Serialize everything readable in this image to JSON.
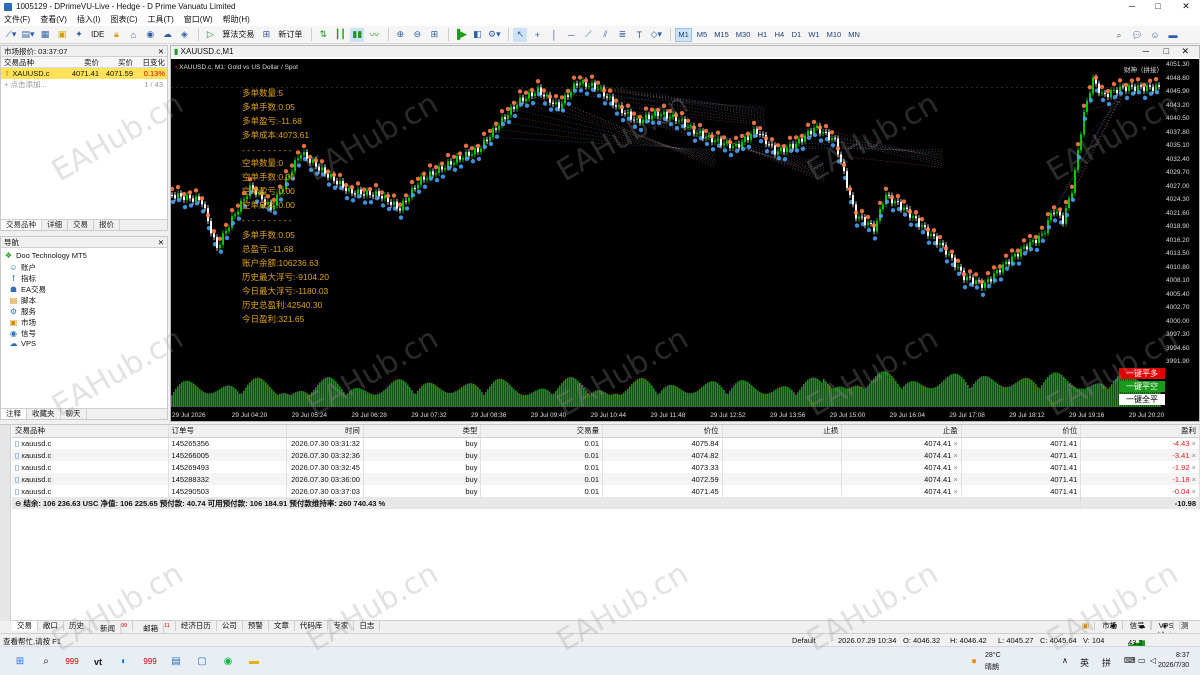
{
  "window": {
    "title": "1005129 - DPrimeVU-Live - Hedge - D Prime Vanuatu Limited",
    "min": "─",
    "max": "□",
    "close": "✕"
  },
  "menu": [
    "文件(F)",
    "查看(V)",
    "插入(I)",
    "图表(C)",
    "工具(T)",
    "窗口(W)",
    "帮助(H)"
  ],
  "toolbar": {
    "ide": "IDE",
    "algo": "算法交易",
    "new_order": "新订单",
    "timeframes": [
      "M1",
      "M5",
      "M15",
      "M30",
      "H1",
      "H4",
      "D1",
      "W1",
      "M10",
      "MN"
    ],
    "active_tf": "M1"
  },
  "market_watch": {
    "title": "市场报价: 03:37:07",
    "cols": [
      "交易品种",
      "卖价",
      "买价",
      "日变化"
    ],
    "row": {
      "symbol": "XAUUSD.c",
      "bid": "4071.41",
      "ask": "4071.59",
      "change": "0.13%"
    },
    "add": "点击添加...",
    "count": "1 / 43",
    "tabs": [
      "交易品种",
      "详细",
      "交易",
      "报价"
    ]
  },
  "navigator": {
    "title": "导航",
    "root": "Doo Technology MT5",
    "items": [
      "账户",
      "指标",
      "EA交易",
      "脚本",
      "服务",
      "市场",
      "信号",
      "VPS"
    ],
    "tabs": [
      "注释",
      "收藏夹",
      "聊天"
    ]
  },
  "chart": {
    "tab": "XAUUSD.c,M1",
    "symbol_label": "XAUUSD.c, M1:  Gold vs US Dollar / Spot",
    "top_right": "财神（拼接）",
    "overlay": [
      "多单数量:5",
      "多单手数:0.05",
      "多单盈亏:-11.68",
      "多单成本:4073.61",
      "空单数量:0",
      "空单手数:0.00",
      "空单盈亏:0.00",
      "空单成本:0.00",
      "多单手数:0.05",
      "总盈亏:-11.68",
      "账户余额:106236.63",
      "历史最大浮亏:-9104.20",
      "今日最大浮亏:-1180.03",
      "历史总盈利:42540.30",
      "今日盈利:321.65"
    ],
    "buttons": {
      "close_long": "一键平多",
      "close_short": "一键平空",
      "close_all": "一键全平"
    },
    "price_axis": [
      "4051.30",
      "4048.60",
      "4045.90",
      "4043.20",
      "4040.50",
      "4037.80",
      "4035.10",
      "4032.40",
      "4029.70",
      "4027.00",
      "4024.30",
      "4021.60",
      "4018.90",
      "4016.20",
      "4013.50",
      "4010.80",
      "4008.10",
      "4005.40",
      "4002.70",
      "4000.00",
      "3997.30",
      "3994.60",
      "3991.90"
    ],
    "time_axis": [
      "29 Jul 2026",
      "29 Jul 04:20",
      "29 Jul 05:24",
      "29 Jul 06:28",
      "29 Jul 07:32",
      "29 Jul 08:36",
      "29 Jul 09:40",
      "29 Jul 10:44",
      "29 Jul 11:48",
      "29 Jul 12:52",
      "29 Jul 13:56",
      "29 Jul 15:00",
      "29 Jul 16:04",
      "29 Jul 17:08",
      "29 Jul 18:12",
      "29 Jul 19:16",
      "29 Jul 20:20"
    ],
    "colors": {
      "bull": "#00c800",
      "bear": "#ffffff",
      "volume": "#1f8f1f",
      "buy_marker": "#ff7a4a",
      "sell_marker": "#4aa8ff",
      "overlay_text": "#e0a21a"
    }
  },
  "orders": {
    "cols": [
      "交易品种",
      "订单号",
      "时间",
      "类型",
      "交易量",
      "价位",
      "止损",
      "止盈",
      "价位",
      "盈利"
    ],
    "rows": [
      {
        "sym": "xauusd.c",
        "id": "145265356",
        "time": "2026.07.30 03:31:32",
        "type": "buy",
        "vol": "0.01",
        "price": "4075.84",
        "sl": "",
        "tp": "4074.41",
        "cur": "4071.41",
        "profit": "-4.43"
      },
      {
        "sym": "xauusd.c",
        "id": "145266005",
        "time": "2026.07.30 03:32:36",
        "type": "buy",
        "vol": "0.01",
        "price": "4074.82",
        "sl": "",
        "tp": "4074.41",
        "cur": "4071.41",
        "profit": "-3.41"
      },
      {
        "sym": "xauusd.c",
        "id": "145269493",
        "time": "2026.07.30 03:32:45",
        "type": "buy",
        "vol": "0.01",
        "price": "4073.33",
        "sl": "",
        "tp": "4074.41",
        "cur": "4071.41",
        "profit": "-1.92"
      },
      {
        "sym": "xauusd.c",
        "id": "145288332",
        "time": "2026.07.30 03:36:00",
        "type": "buy",
        "vol": "0.01",
        "price": "4072.59",
        "sl": "",
        "tp": "4074.41",
        "cur": "4071.41",
        "profit": "-1.18"
      },
      {
        "sym": "xauusd.c",
        "id": "145290503",
        "time": "2026.07.30 03:37:03",
        "type": "buy",
        "vol": "0.01",
        "price": "4071.45",
        "sl": "",
        "tp": "4074.41",
        "cur": "4071.41",
        "profit": "-0.04"
      }
    ],
    "balance_line": "结余: 106 236.63 USC  净值: 106 225.65  预付款: 40.74  可用预付款: 106 184.91  预付款维持率: 260 740.43 %",
    "balance_profit": "-10.98"
  },
  "bottom_tabs": [
    "交易",
    "敞口",
    "历史",
    "新闻",
    "邮箱",
    "经济日历",
    "公司",
    "预警",
    "文章",
    "代码库",
    "专家",
    "日志"
  ],
  "bottom_badges": {
    "news": "99",
    "mail": "11"
  },
  "bottom_right": [
    "市场",
    "信号",
    "VPS",
    "测试"
  ],
  "status": {
    "help": "查看帮忙,请按 F1",
    "profile": "Default",
    "time": "2026.07.29 10:34",
    "open": "O: 4046.32",
    "high": "H: 4046.42",
    "low": "L: 4045.27",
    "close": "C: 4045.64",
    "vol": "V: 104",
    "net": "43.2 / 2.6 Mb"
  },
  "taskbar": {
    "weather_temp": "28°C",
    "weather_desc": "晴朗",
    "ime1": "英",
    "ime2": "拼",
    "clock_time": "8:37",
    "clock_date": "2026/7/30"
  },
  "watermark": "EAHub.cn"
}
